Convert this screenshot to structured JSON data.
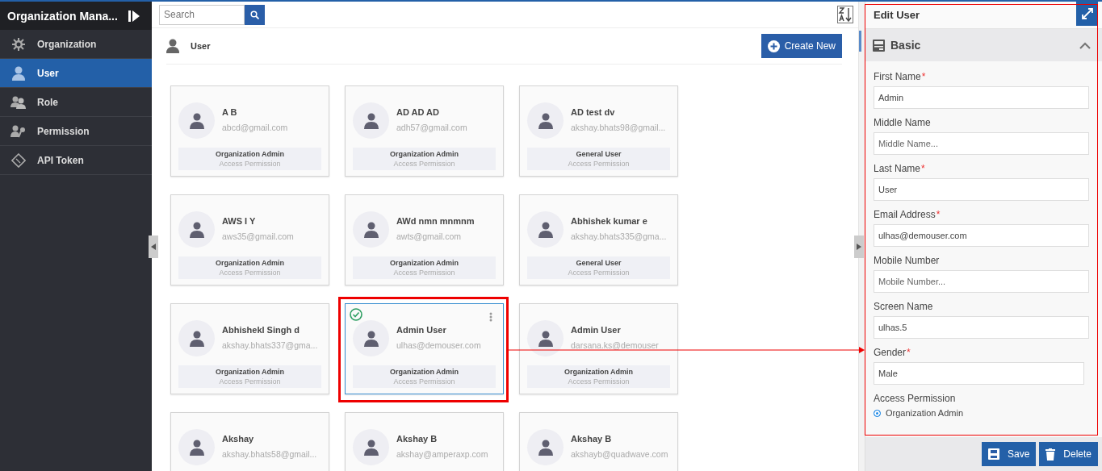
{
  "sidebar": {
    "title": "Organization Mana...",
    "items": [
      {
        "label": "Organization",
        "selected": false
      },
      {
        "label": "User",
        "selected": true
      },
      {
        "label": "Role",
        "selected": false
      },
      {
        "label": "Permission",
        "selected": false
      },
      {
        "label": "API Token",
        "selected": false
      }
    ]
  },
  "search": {
    "placeholder": "Search"
  },
  "section": {
    "title": "User",
    "create_button": "Create New"
  },
  "cards": [
    {
      "name": "A B",
      "email": "abcd@gmail.com",
      "role": "Organization Admin",
      "role_caption": "Access Permission",
      "selected": false
    },
    {
      "name": "AD AD AD",
      "email": "adh57@gmail.com",
      "role": "Organization Admin",
      "role_caption": "Access Permission",
      "selected": false
    },
    {
      "name": "AD test dv",
      "email": "akshay.bhats98@gmail...",
      "role": "General User",
      "role_caption": "Access Permission",
      "selected": false
    },
    {
      "name": "AWS I Y",
      "email": "aws35@gmail.com",
      "role": "Organization Admin",
      "role_caption": "Access Permission",
      "selected": false
    },
    {
      "name": "AWd nmn mnmnm",
      "email": "awts@gmail.com",
      "role": "Organization Admin",
      "role_caption": "Access Permission",
      "selected": false
    },
    {
      "name": "Abhishek kumar e",
      "email": "akshay.bhats335@gma...",
      "role": "General User",
      "role_caption": "Access Permission",
      "selected": false
    },
    {
      "name": "Abhishekl Singh d",
      "email": "akshay.bhats337@gma...",
      "role": "Organization Admin",
      "role_caption": "Access Permission",
      "selected": false
    },
    {
      "name": "Admin User",
      "email": "ulhas@demouser.com",
      "role": "Organization Admin",
      "role_caption": "Access Permission",
      "selected": true
    },
    {
      "name": "Admin User",
      "email": "darsana.ks@demouser",
      "role": "Organization Admin",
      "role_caption": "Access Permission",
      "selected": false
    },
    {
      "name": "Akshay",
      "email": "akshay.bhats58@gmail...",
      "selected": false
    },
    {
      "name": "Akshay B",
      "email": "akshay@amperaxp.com",
      "selected": false
    },
    {
      "name": "Akshay B",
      "email": "akshayb@quadwave.com",
      "selected": false
    }
  ],
  "panel": {
    "title": "Edit User",
    "section": "Basic",
    "expanded": true,
    "fields": [
      {
        "kind": "text",
        "label": "First Name",
        "required_mark": "*",
        "value": "Admin"
      },
      {
        "kind": "text",
        "label": "Middle Name",
        "placeholder": "Middle Name..."
      },
      {
        "kind": "text",
        "label": "Last Name",
        "required_mark": "*",
        "value": "User"
      },
      {
        "kind": "text",
        "label": "Email Address",
        "required_mark": "*",
        "value": "ulhas@demouser.com"
      },
      {
        "kind": "text",
        "label": "Mobile Number",
        "placeholder": "Mobile Number..."
      },
      {
        "kind": "text",
        "label": "Screen Name",
        "value": "ulhas.5"
      },
      {
        "kind": "select",
        "label": "Gender",
        "required_mark": "*",
        "value": "Male"
      },
      {
        "kind": "radio",
        "label": "Access Permission",
        "options": [
          {
            "label": "Organization Admin",
            "selected": true
          }
        ]
      }
    ],
    "buttons": [
      {
        "label": "Save"
      },
      {
        "label": "Delete"
      }
    ]
  },
  "annotations": {
    "highlight_selected_card": true,
    "arrow_to_panel": true,
    "panel_frame": true
  }
}
